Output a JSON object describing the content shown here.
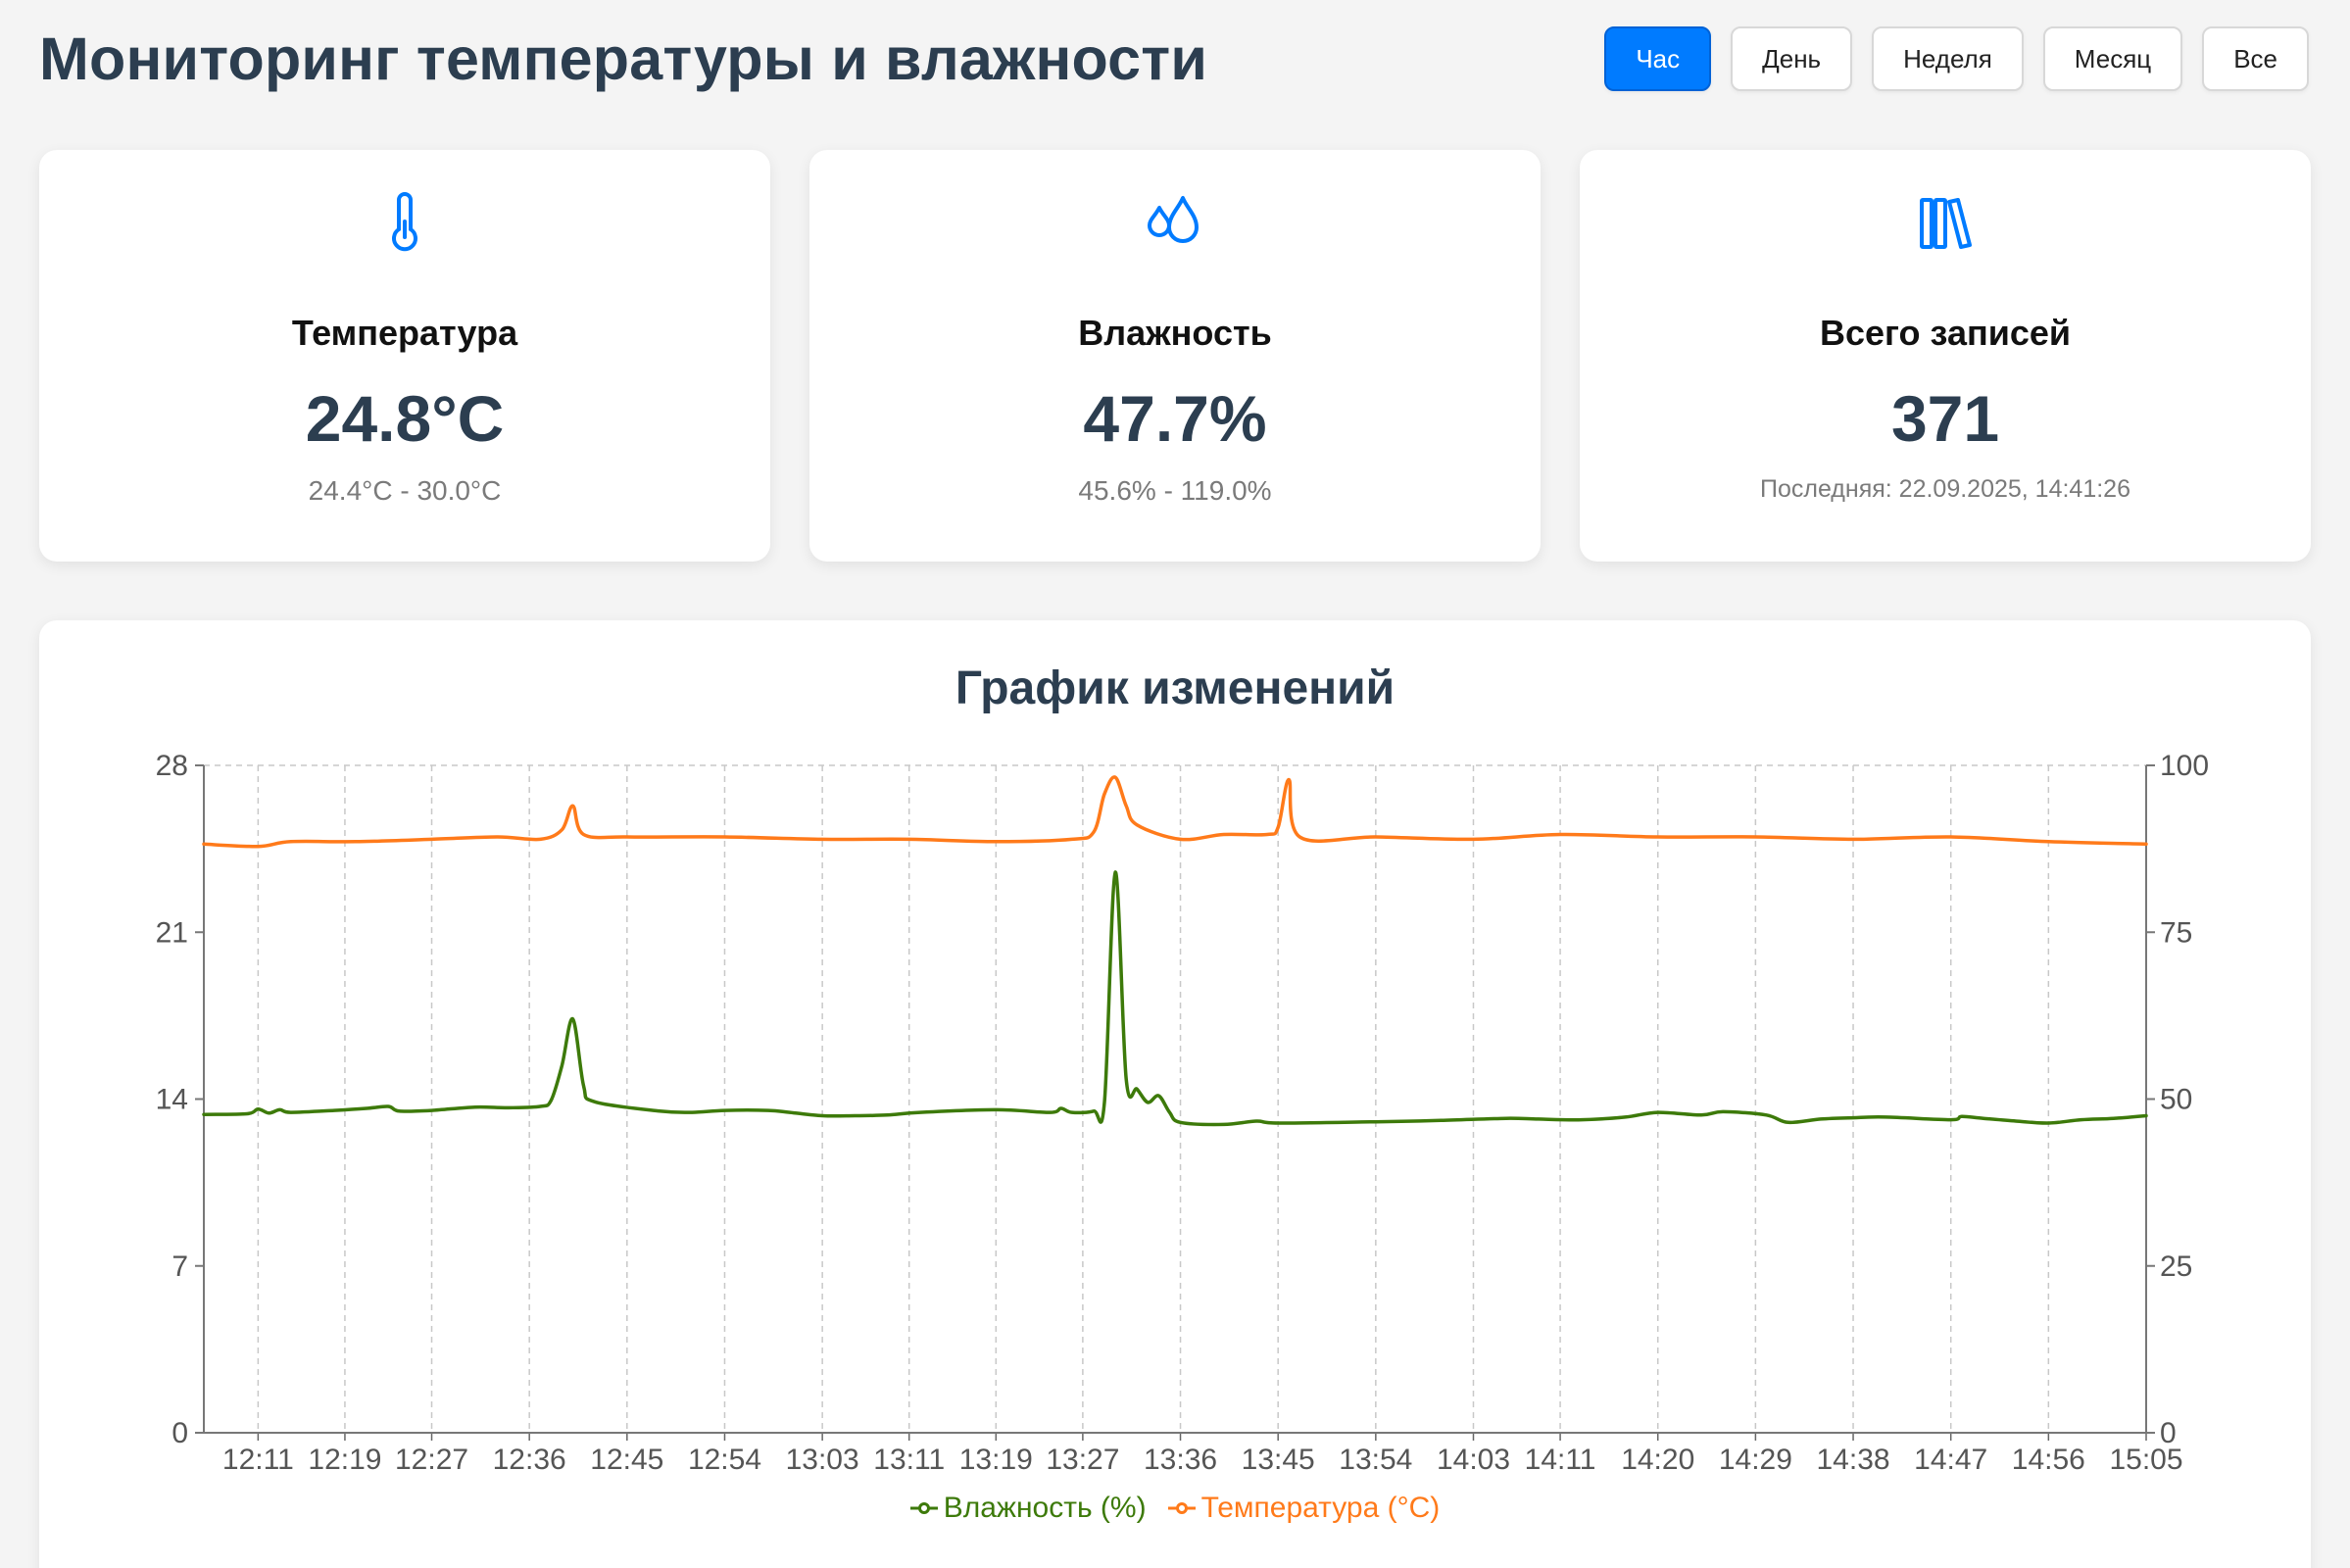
{
  "header": {
    "title": "Мониторинг температуры и влажности",
    "periods": [
      "Час",
      "День",
      "Неделя",
      "Месяц",
      "Все"
    ],
    "active_period": "Час"
  },
  "cards": {
    "temperature": {
      "icon": "thermometer-icon",
      "title": "Температура",
      "value": "24.8°C",
      "range": "24.4°C - 30.0°C"
    },
    "humidity": {
      "icon": "droplets-icon",
      "title": "Влажность",
      "value": "47.7%",
      "range": "45.6% - 119.0%"
    },
    "records": {
      "icon": "library-icon",
      "title": "Всего записей",
      "value": "371",
      "last": "Последняя: 22.09.2025, 14:41:26"
    }
  },
  "colors": {
    "accent": "#007bff",
    "humidity": "#3d7a0a",
    "temperature": "#ff7a1a",
    "title": "#2c3e50"
  },
  "chart": {
    "title": "График изменений",
    "legend": {
      "humidity": "Влажность (%)",
      "temperature": "Температура (°C)"
    }
  },
  "chart_data": {
    "type": "line",
    "title": "График изменений",
    "x_ticks": [
      "12:11",
      "12:19",
      "12:27",
      "12:36",
      "12:45",
      "12:54",
      "13:03",
      "13:11",
      "13:19",
      "13:27",
      "13:36",
      "13:45",
      "13:54",
      "14:03",
      "14:11",
      "14:20",
      "14:29",
      "14:38",
      "14:47",
      "14:56",
      "15:05"
    ],
    "x_range": [
      "12:06",
      "15:05"
    ],
    "y_left": {
      "min": 0,
      "max": 28,
      "ticks": [
        0,
        7,
        14,
        21,
        28
      ],
      "axis_for": "Температура (°C)"
    },
    "y_right": {
      "min": 0,
      "max": 100,
      "ticks": [
        0,
        25,
        50,
        75,
        100
      ],
      "axis_for": "Влажность (%)"
    },
    "grid": "vertical dashed",
    "legend_position": "bottom",
    "series": [
      {
        "name": "Влажность (%)",
        "axis": "right",
        "color": "#3d7a0a",
        "points": [
          [
            "12:06",
            47.7
          ],
          [
            "12:10",
            47.8
          ],
          [
            "12:11",
            48.5
          ],
          [
            "12:12",
            47.9
          ],
          [
            "12:13",
            48.4
          ],
          [
            "12:14",
            48.0
          ],
          [
            "12:18",
            48.3
          ],
          [
            "12:21",
            48.6
          ],
          [
            "12:23",
            48.9
          ],
          [
            "12:24",
            48.2
          ],
          [
            "12:27",
            48.3
          ],
          [
            "12:31",
            48.8
          ],
          [
            "12:34",
            48.7
          ],
          [
            "12:37",
            48.9
          ],
          [
            "12:38",
            49.8
          ],
          [
            "12:39",
            55.0
          ],
          [
            "12:40",
            62.0
          ],
          [
            "12:41",
            52.0
          ],
          [
            "12:42",
            49.6
          ],
          [
            "12:48",
            48.2
          ],
          [
            "12:51",
            48.0
          ],
          [
            "12:54",
            48.3
          ],
          [
            "12:58",
            48.3
          ],
          [
            "13:00",
            48.0
          ],
          [
            "13:03",
            47.5
          ],
          [
            "13:06",
            47.5
          ],
          [
            "13:09",
            47.6
          ],
          [
            "13:12",
            48.0
          ],
          [
            "13:19",
            48.4
          ],
          [
            "13:24",
            48.0
          ],
          [
            "13:25",
            48.6
          ],
          [
            "13:26",
            48.0
          ],
          [
            "13:28",
            48.2
          ],
          [
            "13:29",
            49.5
          ],
          [
            "13:30",
            84.0
          ],
          [
            "13:31",
            53.0
          ],
          [
            "13:32",
            51.5
          ],
          [
            "13:33",
            49.5
          ],
          [
            "13:34",
            50.5
          ],
          [
            "13:35",
            48.0
          ],
          [
            "13:36",
            46.5
          ],
          [
            "13:40",
            46.2
          ],
          [
            "13:43",
            46.7
          ],
          [
            "13:45",
            46.4
          ],
          [
            "13:54",
            46.6
          ],
          [
            "14:00",
            46.8
          ],
          [
            "14:06",
            47.1
          ],
          [
            "14:09",
            47.0
          ],
          [
            "14:13",
            46.9
          ],
          [
            "14:17",
            47.3
          ],
          [
            "14:20",
            48.0
          ],
          [
            "14:24",
            47.6
          ],
          [
            "14:26",
            48.1
          ],
          [
            "14:30",
            47.6
          ],
          [
            "14:32",
            46.5
          ],
          [
            "14:35",
            47.0
          ],
          [
            "14:38",
            47.2
          ],
          [
            "14:41",
            47.3
          ],
          [
            "14:47",
            46.9
          ],
          [
            "14:48",
            47.4
          ],
          [
            "14:50",
            47.1
          ],
          [
            "14:53",
            46.7
          ],
          [
            "14:56",
            46.4
          ],
          [
            "14:59",
            46.9
          ],
          [
            "15:02",
            47.1
          ],
          [
            "15:05",
            47.5
          ]
        ]
      },
      {
        "name": "Температура (°C)",
        "axis": "left",
        "color": "#ff7a1a",
        "points": [
          [
            "12:06",
            24.7
          ],
          [
            "12:11",
            24.6
          ],
          [
            "12:14",
            24.8
          ],
          [
            "12:20",
            24.8
          ],
          [
            "12:27",
            24.9
          ],
          [
            "12:33",
            25.0
          ],
          [
            "12:37",
            24.9
          ],
          [
            "12:39",
            25.3
          ],
          [
            "12:40",
            26.3
          ],
          [
            "12:41",
            25.1
          ],
          [
            "12:45",
            25.0
          ],
          [
            "12:54",
            25.0
          ],
          [
            "13:03",
            24.9
          ],
          [
            "13:11",
            24.9
          ],
          [
            "13:19",
            24.8
          ],
          [
            "13:26",
            24.9
          ],
          [
            "13:28",
            25.2
          ],
          [
            "13:29",
            26.8
          ],
          [
            "13:30",
            27.5
          ],
          [
            "13:31",
            26.3
          ],
          [
            "13:32",
            25.5
          ],
          [
            "13:36",
            24.9
          ],
          [
            "13:40",
            25.1
          ],
          [
            "13:44",
            25.1
          ],
          [
            "13:45",
            25.4
          ],
          [
            "13:46",
            27.4
          ],
          [
            "13:47",
            25.0
          ],
          [
            "13:54",
            25.0
          ],
          [
            "14:03",
            24.9
          ],
          [
            "14:11",
            25.1
          ],
          [
            "14:20",
            25.0
          ],
          [
            "14:29",
            25.0
          ],
          [
            "14:38",
            24.9
          ],
          [
            "14:47",
            25.0
          ],
          [
            "14:56",
            24.8
          ],
          [
            "15:05",
            24.7
          ]
        ]
      }
    ]
  }
}
